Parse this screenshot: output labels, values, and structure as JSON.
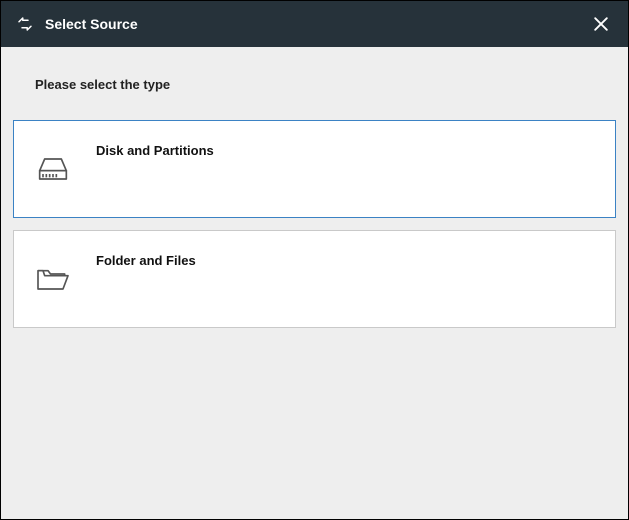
{
  "titlebar": {
    "title": "Select Source"
  },
  "prompt": "Please select the type",
  "options": {
    "disk": {
      "label": "Disk and Partitions"
    },
    "folder": {
      "label": "Folder and Files"
    }
  }
}
